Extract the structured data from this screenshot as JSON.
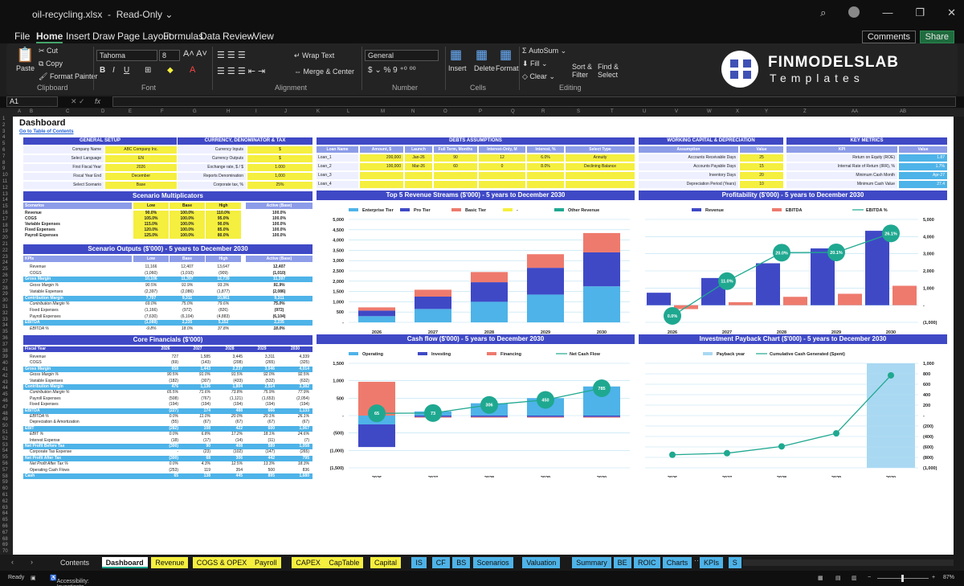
{
  "window": {
    "file_name": "oil-recycling.xlsx",
    "mode": "Read-Only"
  },
  "menu": [
    "File",
    "Home",
    "Insert",
    "Draw",
    "Page Layout",
    "Formulas",
    "Data",
    "Review",
    "View"
  ],
  "menu_actions": {
    "comments": "Comments",
    "share": "Share"
  },
  "ribbon": {
    "paste": "Paste",
    "cut": "Cut",
    "copy": "Copy",
    "format_painter": "Format Painter",
    "clipboard": "Clipboard",
    "font_name": "Tahoma",
    "font_size": "8",
    "font": "Font",
    "wrap_text": "Wrap Text",
    "merge_center": "Merge & Center",
    "alignment": "Alignment",
    "number_format": "General",
    "number": "Number",
    "insert": "Insert",
    "delete": "Delete",
    "format": "Format",
    "cells": "Cells",
    "autosum": "AutoSum",
    "fill": "Fill",
    "clear": "Clear",
    "sort_filter": "Sort & Filter",
    "find_select": "Find & Select",
    "editing": "Editing"
  },
  "logo": {
    "line1": "FINMODELSLAB",
    "line2": "Templates"
  },
  "formula_bar": {
    "name_box": "A1",
    "fx": "fx"
  },
  "columns": [
    "A",
    "B",
    "C",
    "D",
    "E",
    "F",
    "G",
    "H",
    "I",
    "J",
    "K",
    "L",
    "M",
    "N",
    "O",
    "P",
    "Q",
    "R",
    "S",
    "T",
    "U",
    "V",
    "W",
    "X",
    "Y",
    "Z",
    "AA",
    "AB"
  ],
  "sheet": {
    "title": "Dashboard",
    "toc_link": "Go to Table of Contents",
    "general_setup": {
      "title": "GENERAL SETUP",
      "rows": [
        [
          "Company Name",
          "ABC Company Inc."
        ],
        [
          "Select Language",
          "EN"
        ],
        [
          "First Fiscal Year",
          "2026"
        ],
        [
          "Fiscal Year End",
          "December"
        ],
        [
          "Select Scenario",
          "Base"
        ]
      ]
    },
    "currency": {
      "title": "CURRENCY, DENOMINATOR & TAX",
      "rows": [
        [
          "Currency Inputs",
          "$"
        ],
        [
          "Currency Outputs",
          "$"
        ],
        [
          "Exchange rate, $ / $",
          "1.000"
        ],
        [
          "Reports Denomination",
          "1,000"
        ],
        [
          "Corporate tax, %",
          "25%"
        ]
      ]
    },
    "debts": {
      "title": "DEBTS ASSUMPTIONS",
      "headers": [
        "Loan Name",
        "Amount, $",
        "Launch",
        "Full Term, Months",
        "Interest-Only, M",
        "Interest, %",
        "Select Type"
      ],
      "rows": [
        [
          "Loan_1",
          "200,000",
          "Jan-26",
          "90",
          "12",
          "6.0%",
          "Annuity"
        ],
        [
          "Loan_2",
          "100,000",
          "Mar-26",
          "60",
          "0",
          "8.0%",
          "Declining Balance"
        ],
        [
          "Loan_3",
          "",
          "",
          "",
          "",
          "",
          ""
        ],
        [
          "Loan_4",
          "",
          "",
          "",
          "",
          "",
          ""
        ]
      ]
    },
    "working_capital": {
      "title": "WORKING CAPITAL & DEPRECIATION",
      "headers": [
        "Assumption",
        "Value"
      ],
      "rows": [
        [
          "Accounts Receivable Days",
          "25"
        ],
        [
          "Accounts Payable Days",
          "15"
        ],
        [
          "Inventory Days",
          "20"
        ],
        [
          "Depreciation Period (Years)",
          "10"
        ]
      ]
    },
    "key_metrics": {
      "title": "KEY METRICS",
      "headers": [
        "KPI",
        "Value"
      ],
      "rows": [
        [
          "Return on Equity (ROE)",
          "1.87"
        ],
        [
          "Internal Rate of Return (IRR), %",
          "1.7%"
        ],
        [
          "Minimum Cash Month",
          "Apr-27"
        ],
        [
          "Minimum Cash Value",
          "27.4"
        ]
      ]
    },
    "scenario_multipliers": {
      "title": "Scenario Multiplicators",
      "headers": [
        "Scenarios",
        "Low",
        "Base",
        "High",
        "Active (Base)"
      ],
      "rows": [
        [
          "Revenue",
          "90.0%",
          "100.0%",
          "110.0%",
          "100.0%"
        ],
        [
          "COGS",
          "105.0%",
          "100.0%",
          "95.0%",
          "100.0%"
        ],
        [
          "Variable Expenses",
          "115.0%",
          "100.0%",
          "90.0%",
          "100.0%"
        ],
        [
          "Fixed Expenses",
          "120.0%",
          "100.0%",
          "85.0%",
          "100.0%"
        ],
        [
          "Payroll Expenses",
          "125.0%",
          "100.0%",
          "80.0%",
          "100.0%"
        ]
      ]
    },
    "scenario_outputs": {
      "title": "Scenario Outputs ($'000) - 5 years to December 2030",
      "headers": [
        "KPIs",
        "Low",
        "Base",
        "High",
        "Active (Base)"
      ],
      "rows": [
        {
          "s": "",
          "c": [
            "Revenue",
            "11,166",
            "12,407",
            "13,647",
            "12,407"
          ]
        },
        {
          "s": "",
          "c": [
            "COGS",
            "(1,060)",
            "(1,010)",
            "(909)",
            "(1,010)"
          ]
        },
        {
          "s": "hl",
          "c": [
            "Gross Margin",
            "10,106",
            "11,397",
            "12,739",
            "11,397"
          ]
        },
        {
          "s": "it",
          "c": [
            "Gross Margin %",
            "90.5%",
            "91.9%",
            "93.3%",
            "91.9%"
          ]
        },
        {
          "s": "",
          "c": [
            "Variable Expenses",
            "(2,397)",
            "(2,086)",
            "(1,877)",
            "(2,086)"
          ]
        },
        {
          "s": "hl",
          "c": [
            "Contribution Margin",
            "7,707",
            "9,311",
            "10,861",
            "9,311"
          ]
        },
        {
          "s": "it",
          "c": [
            "Contribution Margin %",
            "69.0%",
            "75.0%",
            "79.6%",
            "75.0%"
          ]
        },
        {
          "s": "",
          "c": [
            "Fixed Expenses",
            "(1,166)",
            "(972)",
            "(826)",
            "(972)"
          ]
        },
        {
          "s": "",
          "c": [
            "Payroll Expenses",
            "(7,630)",
            "(6,104)",
            "(4,883)",
            "(6,104)"
          ]
        },
        {
          "s": "hl",
          "c": [
            "EBITDA",
            "(1,089)",
            "2,235",
            "5,152",
            "2,235"
          ]
        },
        {
          "s": "it",
          "c": [
            "EBITDA %",
            "-9.8%",
            "18.0%",
            "37.8%",
            "18.0%"
          ]
        }
      ]
    },
    "core_financials": {
      "title": "Core Financials ($'000)",
      "headers": [
        "Fiscal Year",
        "2026",
        "2027",
        "2028",
        "2029",
        "2030"
      ],
      "rows": [
        {
          "s": "",
          "c": [
            "Revenue",
            "727",
            "1,585",
            "3,445",
            "3,311",
            "4,339"
          ]
        },
        {
          "s": "",
          "c": [
            "COGS",
            "(69)",
            "(143)",
            "(208)",
            "(265)",
            "(325)"
          ]
        },
        {
          "s": "hl",
          "c": [
            "Gross Margin",
            "658",
            "1,443",
            "2,237",
            "3,046",
            "4,014"
          ]
        },
        {
          "s": "it",
          "c": [
            "Gross Margin %",
            "90.5%",
            "91.0%",
            "91.5%",
            "92.0%",
            "92.5%"
          ]
        },
        {
          "s": "",
          "c": [
            "Variable Expenses",
            "(182)",
            "(307)",
            "(433)",
            "(532)",
            "(632)"
          ]
        },
        {
          "s": "hl",
          "c": [
            "Contribution Margin",
            "476",
            "1,136",
            "1,804",
            "2,514",
            "3,382"
          ]
        },
        {
          "s": "it",
          "c": [
            "Contribution Margin %",
            "65.5%",
            "71.6%",
            "73.8%",
            "75.9%",
            "77.9%"
          ]
        },
        {
          "s": "",
          "c": [
            "Payroll Expenses",
            "(508)",
            "(767)",
            "(1,121)",
            "(1,653)",
            "(2,054)"
          ]
        },
        {
          "s": "",
          "c": [
            "Fixed Expenses",
            "(194)",
            "(194)",
            "(194)",
            "(194)",
            "(194)"
          ]
        },
        {
          "s": "hl",
          "c": [
            "EBITDA",
            "(227)",
            "174",
            "488",
            "666",
            "1,133"
          ]
        },
        {
          "s": "it",
          "c": [
            "EBITDA %",
            "0.0%",
            "11.0%",
            "20.0%",
            "20.1%",
            "26.1%"
          ]
        },
        {
          "s": "",
          "c": [
            "Depreciation & Amortization",
            "(55)",
            "(67)",
            "(67)",
            "(67)",
            "(67)"
          ]
        },
        {
          "s": "hl",
          "c": [
            "EBIT",
            "(282)",
            "108",
            "422",
            "600",
            "1,067"
          ]
        },
        {
          "s": "it",
          "c": [
            "EBIT %",
            "0.0%",
            "6.8%",
            "17.2%",
            "18.1%",
            "24.6%"
          ]
        },
        {
          "s": "",
          "c": [
            "Interest Expense",
            "(18)",
            "(17)",
            "(14)",
            "(11)",
            "(7)"
          ]
        },
        {
          "s": "hl",
          "c": [
            "Net Profit Before Tax",
            "(300)",
            "90",
            "408",
            "589",
            "1,058"
          ]
        },
        {
          "s": "",
          "c": [
            "Corporate Tax Expense",
            "-",
            "(23)",
            "(102)",
            "(147)",
            "(265)"
          ]
        },
        {
          "s": "hl",
          "c": [
            "Net Profit After Tax",
            "(300)",
            "68",
            "306",
            "442",
            "795"
          ]
        },
        {
          "s": "it",
          "c": [
            "Net Profit After Tax %",
            "0.0%",
            "4.3%",
            "12.5%",
            "13.3%",
            "18.3%"
          ]
        },
        {
          "s": "",
          "c": [
            "Operating Cash Flows",
            "(253)",
            "119",
            "354",
            "500",
            "836"
          ]
        },
        {
          "s": "hl",
          "c": [
            "Cash",
            "65",
            "138",
            "445",
            "895",
            "1,680"
          ]
        }
      ]
    }
  },
  "chart_data": [
    {
      "type": "bar",
      "title": "Top 5 Revenue Streams ($'000) - 5 years to December 2030",
      "categories": [
        "2026",
        "2027",
        "2028",
        "2029",
        "2030"
      ],
      "ylim": [
        0,
        5000
      ],
      "yticks": [
        "-",
        "500",
        "1,000",
        "1,500",
        "2,000",
        "2,500",
        "3,000",
        "3,500",
        "4,000",
        "4,500",
        "5,000"
      ],
      "legend": [
        "Enterprise Tier",
        "Pro Tier",
        "Basic Tier",
        "-",
        "Other Revenue"
      ],
      "colors": [
        "#4eb3e8",
        "#3f49c6",
        "#ee7a6d",
        "#f5ef3f",
        "#1fa890"
      ],
      "series": [
        {
          "name": "Enterprise Tier",
          "values": [
            300,
            650,
            1000,
            1350,
            1750
          ]
        },
        {
          "name": "Pro Tier",
          "values": [
            270,
            600,
            950,
            1300,
            1650
          ]
        },
        {
          "name": "Basic Tier",
          "values": [
            157,
            335,
            495,
            661,
            939
          ]
        }
      ]
    },
    {
      "type": "bar",
      "title": "Profitability ($'000) - 5 years to December 2030",
      "categories": [
        "2026",
        "2027",
        "2028",
        "2029",
        "2030"
      ],
      "ylim": [
        -1000,
        5000
      ],
      "yticks": [
        "(1,000)",
        "-",
        "1,000",
        "2,000",
        "3,000",
        "4,000",
        "5,000"
      ],
      "legend": [
        "Revenue",
        "EBITDA",
        "EBITDA %"
      ],
      "colors": [
        "#3f49c6",
        "#ee7a6d",
        "#1fa890"
      ],
      "series": [
        {
          "name": "Revenue",
          "values": [
            727,
            1585,
            2445,
            3311,
            4339
          ]
        },
        {
          "name": "EBITDA",
          "values": [
            -227,
            174,
            488,
            666,
            1133
          ]
        },
        {
          "name": "EBITDA %",
          "values": [
            0.0,
            11.0,
            20.0,
            20.1,
            26.1
          ],
          "labels": [
            "0.0%",
            "11.0%",
            "20.0%",
            "20.1%",
            "26.1%"
          ]
        }
      ]
    },
    {
      "type": "bar",
      "title": "Cash flow ($'000) - 5 years to December 2030",
      "categories": [
        "2026",
        "2027",
        "2028",
        "2029",
        "2030"
      ],
      "ylim": [
        -1500,
        1500
      ],
      "yticks": [
        "(1,500)",
        "(1,000)",
        "(500)",
        "-",
        "500",
        "1,000",
        "1,500"
      ],
      "legend": [
        "Operating",
        "Investing",
        "Financing",
        "Net Cash Flow"
      ],
      "colors": [
        "#4eb3e8",
        "#3f49c6",
        "#ee7a6d",
        "#1fa890"
      ],
      "series": [
        {
          "name": "Operating",
          "values": [
            -253,
            119,
            354,
            500,
            836
          ]
        },
        {
          "name": "Investing",
          "values": [
            -650,
            -40,
            -40,
            -40,
            -40
          ]
        },
        {
          "name": "Financing",
          "values": [
            970,
            -20,
            -20,
            -20,
            -20
          ]
        },
        {
          "name": "Net Cash Flow",
          "values": [
            65,
            73,
            306,
            450,
            785
          ]
        }
      ]
    },
    {
      "type": "line",
      "title": "Investment Payback Chart ($'000) - 5 years to December 2030",
      "categories": [
        "2026",
        "2027",
        "2028",
        "2029",
        "2030"
      ],
      "ylim": [
        -1000,
        1000
      ],
      "yticks": [
        "(1,000)",
        "(800)",
        "(600)",
        "(400)",
        "(200)",
        "-",
        "200",
        "400",
        "600",
        "800",
        "1,000"
      ],
      "legend": [
        "Payback year",
        "Cumulative Cash Generated (Spent)"
      ],
      "colors": [
        "#a9d8f2",
        "#1fa890"
      ],
      "payback_year": "2030",
      "series": [
        {
          "name": "Cumulative Cash Generated (Spent)",
          "values": [
            -750,
            -720,
            -590,
            -340,
            770
          ]
        }
      ]
    }
  ],
  "tabs": [
    {
      "label": "Contents",
      "c": "#1a1a1a",
      "t": "#ddd"
    },
    {
      "label": "Dashboard",
      "c": "#ffffff",
      "t": "#111"
    },
    {
      "label": "Revenue",
      "c": "#f5ef3f",
      "t": "#111"
    },
    {
      "label": "COGS & OPEX",
      "c": "#f5ef3f",
      "t": "#111"
    },
    {
      "label": "Payroll",
      "c": "#f5ef3f",
      "t": "#111"
    },
    {
      "label": "CAPEX",
      "c": "#f5ef3f",
      "t": "#111"
    },
    {
      "label": "CapTable",
      "c": "#f5ef3f",
      "t": "#111"
    },
    {
      "label": "Capital",
      "c": "#f5ef3f",
      "t": "#111"
    },
    {
      "label": "IS",
      "c": "#4eb3e8",
      "t": "#111"
    },
    {
      "label": "CF",
      "c": "#4eb3e8",
      "t": "#111"
    },
    {
      "label": "BS",
      "c": "#4eb3e8",
      "t": "#111"
    },
    {
      "label": "Scenarios",
      "c": "#4eb3e8",
      "t": "#111"
    },
    {
      "label": "Valuation",
      "c": "#4eb3e8",
      "t": "#111"
    },
    {
      "label": "Summary",
      "c": "#4eb3e8",
      "t": "#111"
    },
    {
      "label": "BE",
      "c": "#4eb3e8",
      "t": "#111"
    },
    {
      "label": "ROIC",
      "c": "#4eb3e8",
      "t": "#111"
    },
    {
      "label": "Charts",
      "c": "#4eb3e8",
      "t": "#111"
    },
    {
      "label": "KPIs",
      "c": "#4eb3e8",
      "t": "#111"
    },
    {
      "label": "S",
      "c": "#4eb3e8",
      "t": "#111"
    }
  ],
  "status": {
    "ready": "Ready",
    "accessibility": "Accessibility: Investigate",
    "zoom": "87%"
  }
}
